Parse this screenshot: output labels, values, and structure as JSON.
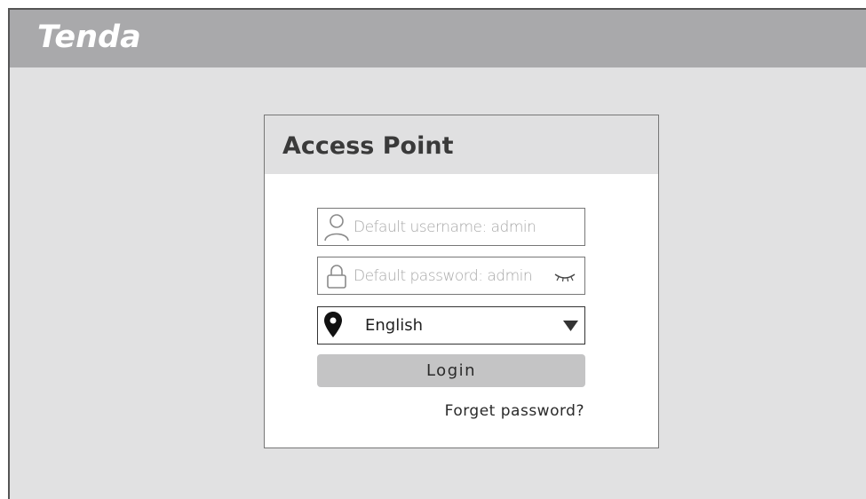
{
  "brand": {
    "logo_text": "Tenda"
  },
  "login": {
    "title": "Access Point",
    "username_placeholder": "Default username: admin",
    "password_placeholder": "Default password: admin",
    "language_selected": "English",
    "login_label": "Login",
    "forget_label": "Forget password?"
  },
  "icons": {
    "username": "user-icon",
    "password": "lock-icon",
    "reveal": "eye-closed-icon",
    "language": "location-pin-icon",
    "dropdown": "caret-down-icon"
  },
  "colors": {
    "topbar": "#a9a9ab",
    "background": "#e1e1e2",
    "header": "#e0e0e1",
    "button": "#c4c4c5",
    "logo": "#ffffff"
  }
}
